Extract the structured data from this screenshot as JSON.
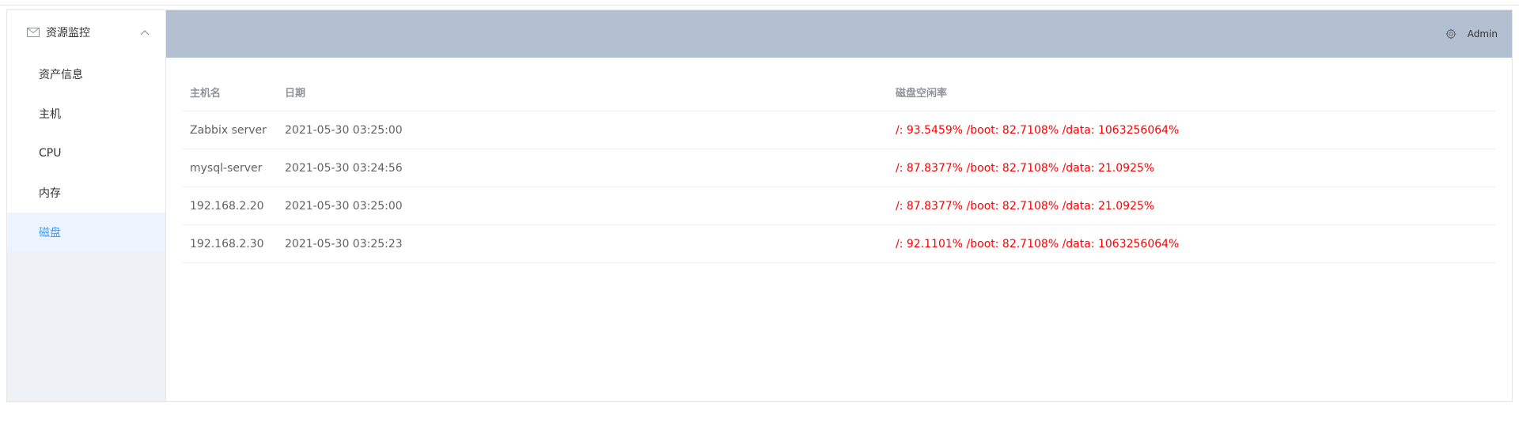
{
  "sidebar": {
    "menu_title": "资源监控",
    "items": [
      {
        "label": "资产信息",
        "active": false
      },
      {
        "label": "主机",
        "active": false
      },
      {
        "label": "CPU",
        "active": false
      },
      {
        "label": "内存",
        "active": false
      },
      {
        "label": "磁盘",
        "active": true
      }
    ],
    "icons": {
      "title_icon": "envelope-icon",
      "collapse_icon": "chevron-up-icon"
    }
  },
  "header": {
    "settings_icon": "gear-icon",
    "user_label": "Admin"
  },
  "table": {
    "columns": [
      "主机名",
      "日期",
      "磁盘空闲率"
    ],
    "rows": [
      {
        "host": "Zabbix server",
        "date": "2021-05-30 03:25:00",
        "disk": "/: 93.5459% /boot: 82.7108% /data: 1063256064%"
      },
      {
        "host": "mysql-server",
        "date": "2021-05-30 03:24:56",
        "disk": "/: 87.8377% /boot: 82.7108% /data: 21.0925%"
      },
      {
        "host": "192.168.2.20",
        "date": "2021-05-30 03:25:00",
        "disk": "/: 87.8377% /boot: 82.7108% /data: 21.0925%"
      },
      {
        "host": "192.168.2.30",
        "date": "2021-05-30 03:25:23",
        "disk": "/: 92.1101% /boot: 82.7108% /data: 1063256064%"
      }
    ]
  },
  "colors": {
    "header_bg": "#b3c0d1",
    "active_item": "#409eff",
    "active_bg": "#ecf5ff",
    "disk_text": "#ff0000"
  }
}
